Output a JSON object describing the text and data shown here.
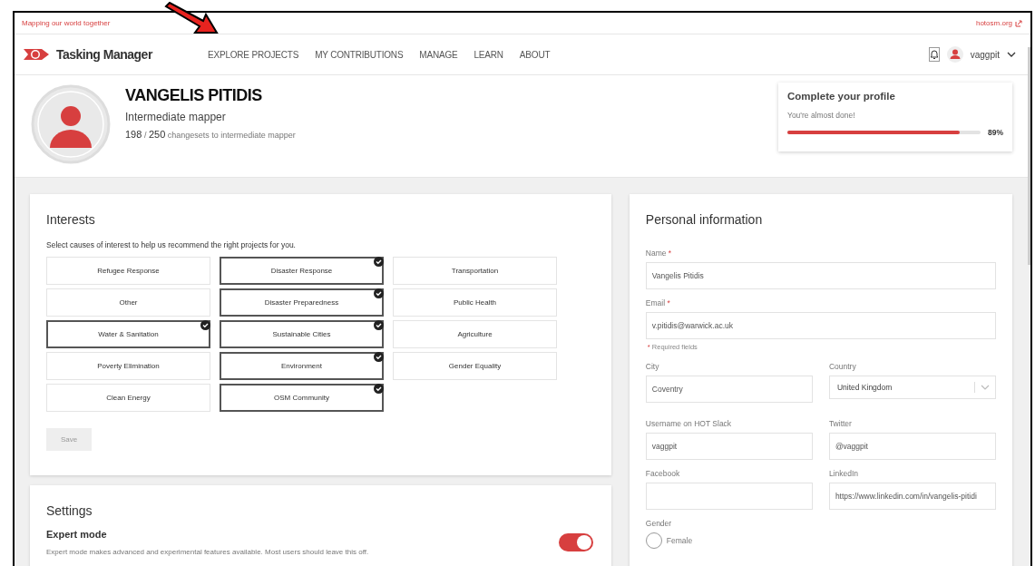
{
  "top_bar": {
    "tagline": "Mapping our world together",
    "link": "hotosm.org"
  },
  "nav": {
    "brand": "Tasking Manager",
    "items": [
      {
        "label": "EXPLORE PROJECTS",
        "selected": false
      },
      {
        "label": "MY CONTRIBUTIONS",
        "selected": false
      },
      {
        "label": "MANAGE",
        "selected": false
      },
      {
        "label": "LEARN",
        "selected": false
      },
      {
        "label": "ABOUT",
        "selected": false
      }
    ],
    "username": "vaggpit"
  },
  "profile": {
    "name": "VANGELIS PITIDIS",
    "level_name": "Intermediate mapper",
    "changesets": "198",
    "separator": "/",
    "target": "250",
    "progress_text": "changesets to intermediate mapper"
  },
  "completion": {
    "title": "Complete your profile",
    "message": "You're almost done!",
    "level": 0.89,
    "percent": "89%"
  },
  "interests": {
    "title": "Interests",
    "description": "Select causes of interest to help us recommend the right projects for you.",
    "items": [
      {
        "label": "Refugee Response",
        "selected": false
      },
      {
        "label": "Disaster Response",
        "selected": true
      },
      {
        "label": "Transportation",
        "selected": false
      },
      {
        "label": "Other",
        "selected": false
      },
      {
        "label": "Disaster Preparedness",
        "selected": true
      },
      {
        "label": "Public Health",
        "selected": false
      },
      {
        "label": "Water & Sanitation",
        "selected": true
      },
      {
        "label": "Sustainable Cities",
        "selected": true
      },
      {
        "label": "Agriculture",
        "selected": false
      },
      {
        "label": "Poverty Elimination",
        "selected": false
      },
      {
        "label": "Environment",
        "selected": true
      },
      {
        "label": "Gender Equality",
        "selected": false
      },
      {
        "label": "Clean Energy",
        "selected": false
      },
      {
        "label": "OSM Community",
        "selected": true
      }
    ],
    "save": {
      "label": "Save",
      "disabled": true
    }
  },
  "settings": {
    "title": "Settings",
    "items": [
      {
        "title": "Expert mode",
        "description": "Expert mode makes advanced and experimental features available. Most users should leave this off.",
        "on": true
      }
    ]
  },
  "personal": {
    "title": "Personal information",
    "rows": [
      [
        {
          "kind": "text",
          "label": "Name",
          "required_mark": "*",
          "value": "Vangelis Pitidis"
        }
      ],
      [
        {
          "kind": "text",
          "label": "Email",
          "required_mark": "*",
          "value": "v.pitidis@warwick.ac.uk"
        }
      ],
      [
        {
          "kind": "note",
          "mark": "*",
          "label": "Required fields"
        }
      ],
      [
        {
          "kind": "text",
          "label": "City",
          "value": "Coventry"
        },
        {
          "kind": "select",
          "label": "Country",
          "value": "United Kingdom"
        }
      ],
      [
        {
          "kind": "text",
          "label": "Username on HOT Slack",
          "value": "vaggpit"
        },
        {
          "kind": "text",
          "label": "Twitter",
          "value": "@vaggpit"
        }
      ],
      [
        {
          "kind": "text",
          "label": "Facebook"
        },
        {
          "kind": "text",
          "label": "LinkedIn",
          "value": "https://www.linkedin.com/in/vangelis-pitidi"
        }
      ],
      [
        {
          "kind": "radio",
          "label": "Gender",
          "options": [
            {
              "label": "Female",
              "selected": false
            }
          ]
        }
      ]
    ]
  }
}
